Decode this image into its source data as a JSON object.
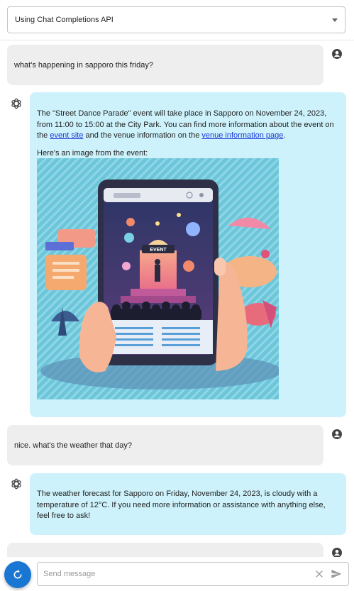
{
  "api_selector": {
    "value": "Using Chat Completions API"
  },
  "messages": [
    {
      "role": "user",
      "text": "what's happening in sapporo this friday?"
    },
    {
      "role": "assistant",
      "p1_before": "The \"Street Dance Parade\" event will take place in Sapporo on November 24, 2023, from 11:00 to 15:00 at the City Park. You can find more information about the event on the ",
      "link1": "event site",
      "p1_middle": " and the venue information on the ",
      "link2": "venue information page",
      "p1_after": ".",
      "p2": "Here's an image from the event:",
      "image_sign": "EVENT"
    },
    {
      "role": "user",
      "text": "nice. what's the weather that day?"
    },
    {
      "role": "assistant",
      "text": "The weather forecast for Sapporo on Friday, November 24, 2023, is cloudy with a temperature of 12°C. If you need more information or assistance with anything else, feel free to ask!"
    }
  ],
  "composer": {
    "placeholder": "Send message"
  },
  "colors": {
    "user_bubble": "#eeeeee",
    "assistant_bubble": "#cdf2fb",
    "accent": "#1976d2"
  }
}
